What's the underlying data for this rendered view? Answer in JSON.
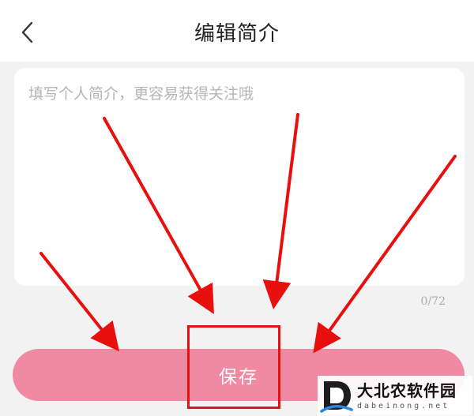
{
  "header": {
    "title": "编辑简介",
    "back_icon": "chevron-left-icon"
  },
  "bio": {
    "placeholder": "填写个人简介，更容易获得关注哦",
    "value": "",
    "counter": "0/72"
  },
  "actions": {
    "save_label": "保存"
  },
  "annotations": {
    "arrow_color": "#e80f0f",
    "arrow_count": 4,
    "highlight_target": "save-button"
  },
  "watermark": {
    "name": "大北农软件园",
    "domain": "dabeinong.net"
  },
  "colors": {
    "header_bg": "#ffffff",
    "page_bg": "#f2f2f2",
    "button_bg": "#f08aa3",
    "annotation_red": "#e80f0f"
  }
}
